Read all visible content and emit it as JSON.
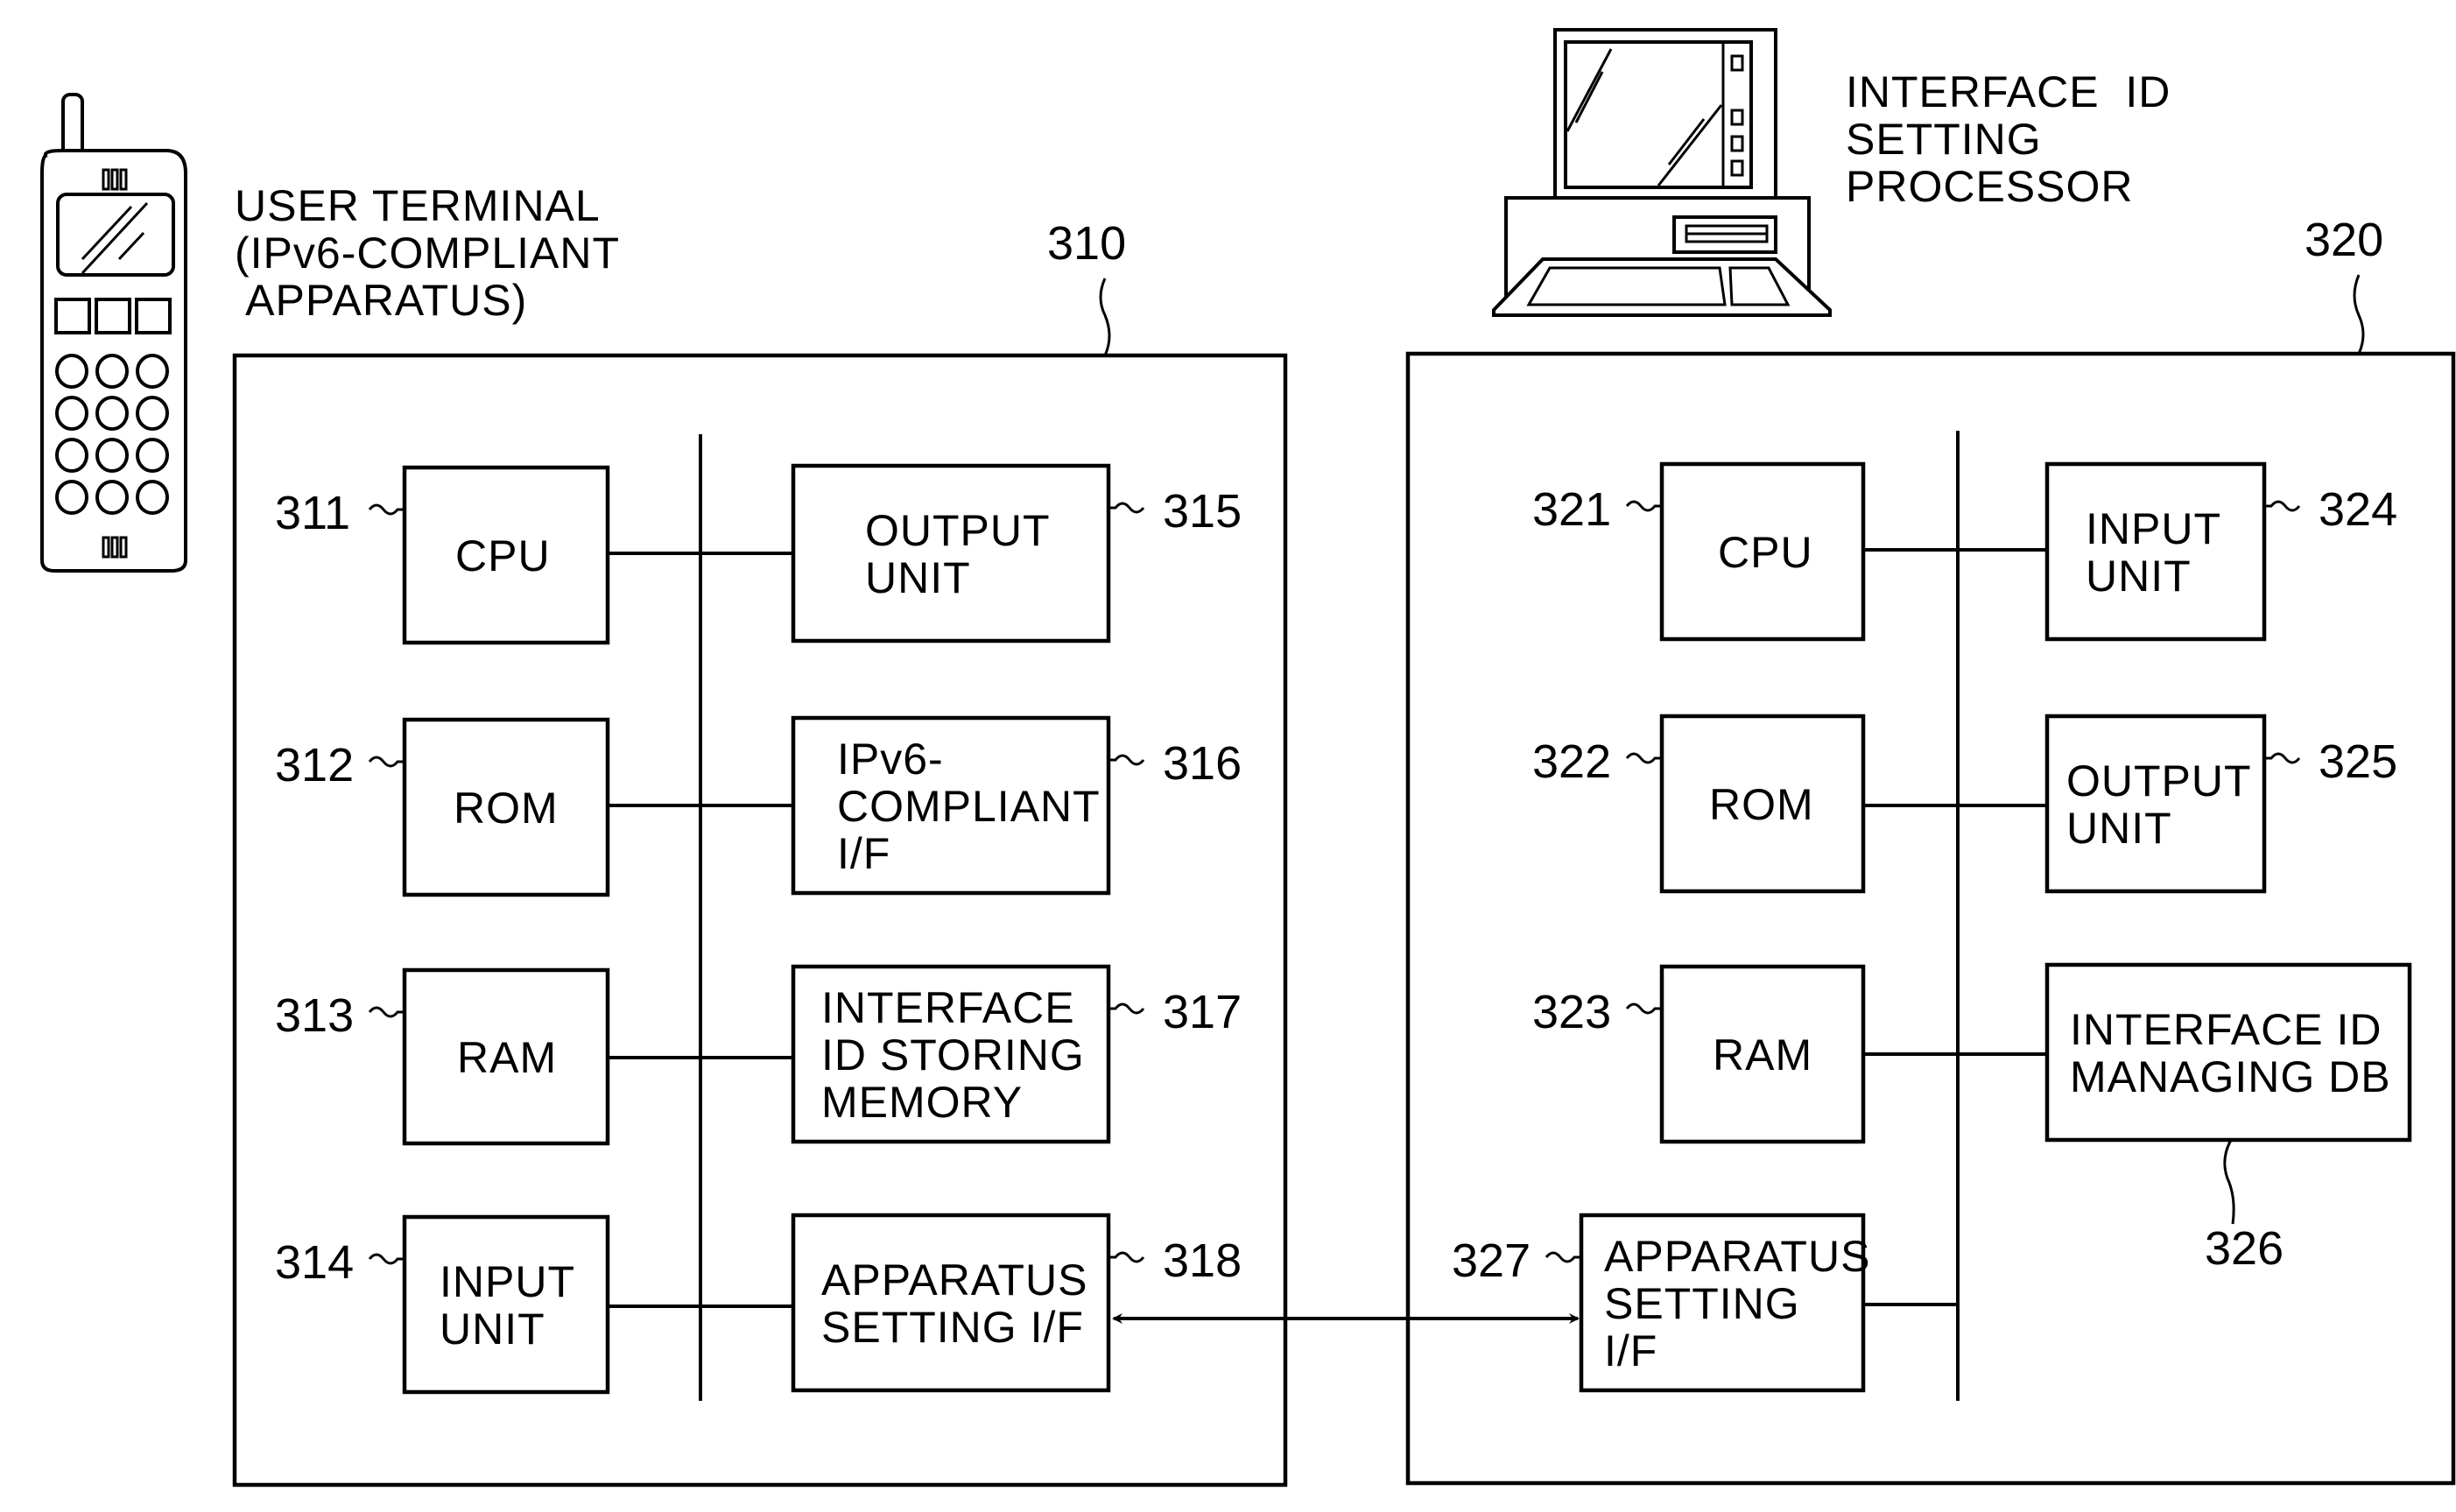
{
  "figure": {
    "user_terminal": {
      "label_lines": [
        "USER TERMINAL",
        "(IPv6-COMPLIANT",
        " APPARATUS)"
      ],
      "ref": "310",
      "icon": "mobile-phone-icon",
      "blocks": [
        {
          "ref": "311",
          "lines": [
            "CPU"
          ]
        },
        {
          "ref": "312",
          "lines": [
            "ROM"
          ]
        },
        {
          "ref": "313",
          "lines": [
            "RAM"
          ]
        },
        {
          "ref": "314",
          "lines": [
            "INPUT",
            "UNIT"
          ]
        },
        {
          "ref": "315",
          "lines": [
            "OUTPUT",
            "UNIT"
          ]
        },
        {
          "ref": "316",
          "lines": [
            "IPv6-",
            "COMPLIANT",
            "I/F"
          ]
        },
        {
          "ref": "317",
          "lines": [
            "INTERFACE",
            "ID  STORING",
            "MEMORY"
          ]
        },
        {
          "ref": "318",
          "lines": [
            "APPARATUS",
            "SETTING  I/F"
          ]
        }
      ]
    },
    "setting_processor": {
      "label_lines": [
        "INTERFACE  ID",
        "SETTING",
        "PROCESSOR"
      ],
      "ref": "320",
      "icon": "desktop-computer-icon",
      "blocks": [
        {
          "ref": "321",
          "lines": [
            "CPU"
          ]
        },
        {
          "ref": "322",
          "lines": [
            "ROM"
          ]
        },
        {
          "ref": "323",
          "lines": [
            "RAM"
          ]
        },
        {
          "ref": "324",
          "lines": [
            "INPUT",
            "UNIT"
          ]
        },
        {
          "ref": "325",
          "lines": [
            "OUTPUT",
            "UNIT"
          ]
        },
        {
          "ref": "326",
          "lines": [
            "INTERFACE  ID",
            "MANAGING  DB"
          ]
        },
        {
          "ref": "327",
          "lines": [
            "APPARATUS",
            "SETTING",
            "I/F"
          ]
        }
      ]
    },
    "connection": {
      "from": "318",
      "to": "327",
      "type": "bidirectional-arrow"
    }
  }
}
